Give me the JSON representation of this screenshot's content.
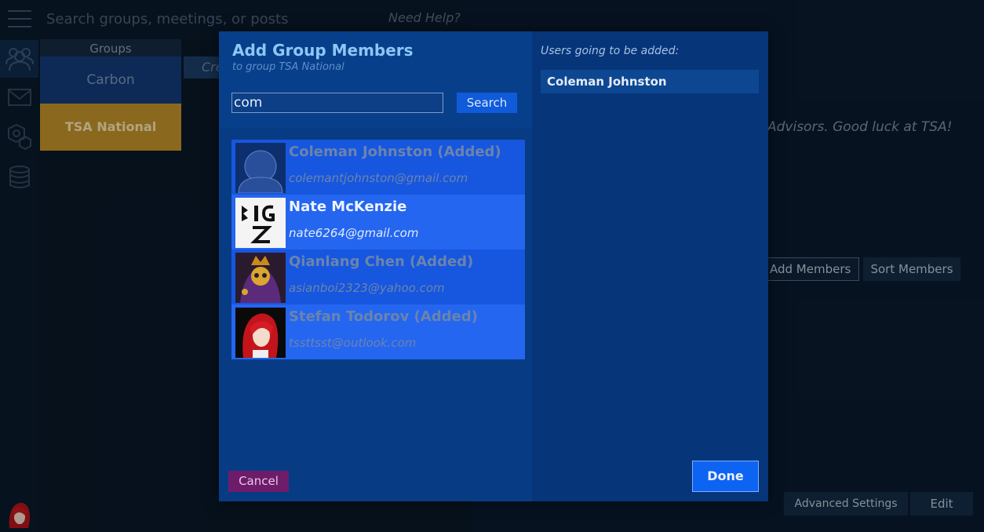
{
  "topbar": {
    "search_placeholder": "Search groups, meetings, or posts",
    "help_label": "Need Help?"
  },
  "groups": {
    "header": "Groups",
    "items": [
      {
        "label": "Carbon"
      },
      {
        "label": "TSA National"
      }
    ],
    "create_label": "Cre"
  },
  "main": {
    "welcome_tail": "Advisors. Good luck at TSA!",
    "add_members_label": "Add Members",
    "sort_members_label": "Sort Members",
    "advanced_settings_label": "Advanced Settings",
    "edit_label": "Edit"
  },
  "modal": {
    "title": "Add Group Members",
    "subtitle": "to group TSA National",
    "search_value": "com",
    "search_button": "Search",
    "results": [
      {
        "name": "Coleman Johnston (Added)",
        "email": "colemantjohnston@gmail.com",
        "added": true
      },
      {
        "name": "Nate McKenzie",
        "email": "nate6264@gmail.com",
        "added": false
      },
      {
        "name": "Qianlang Chen (Added)",
        "email": "asianboi2323@yahoo.com",
        "added": true
      },
      {
        "name": "Stefan Todorov (Added)",
        "email": "tssttsst@outlook.com",
        "added": true
      }
    ],
    "cancel_label": "Cancel",
    "pending_label": "Users going to be added:",
    "pending_users": [
      "Coleman Johnston"
    ],
    "done_label": "Done"
  },
  "colors": {
    "modal_bg": "#073c84",
    "accent_button": "#0d63f2",
    "cancel_button": "#6e1c6a",
    "group_active": "#c0912a",
    "group_carbon": "#123b78",
    "result_row_a": "#1756de",
    "result_row_b": "#2566f0"
  },
  "icons": {
    "menu": "hamburger-menu-icon",
    "groups": "people-icon",
    "messages": "envelope-icon",
    "settings": "hexagon-gear-icon",
    "data": "database-icon",
    "avatar_placeholder": "user-silhouette-icon"
  }
}
